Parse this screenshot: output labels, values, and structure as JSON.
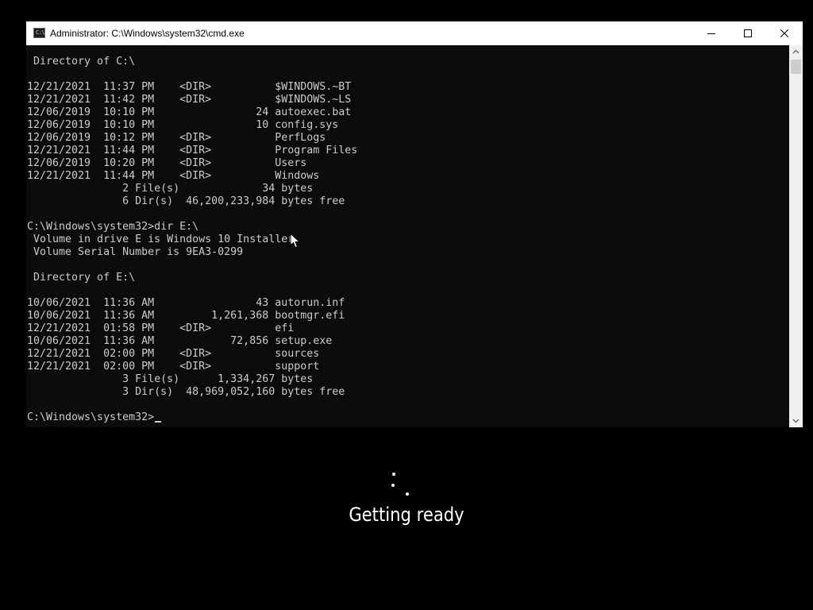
{
  "window": {
    "title": "Administrator: C:\\Windows\\system32\\cmd.exe",
    "icon": "cmd-console-icon",
    "icon_glyph": "C:\\"
  },
  "console": {
    "lines": [
      " Directory of C:\\",
      "",
      "12/21/2021  11:37 PM    <DIR>          $WINDOWS.~BT",
      "12/21/2021  11:42 PM    <DIR>          $WINDOWS.~LS",
      "12/06/2019  10:10 PM                24 autoexec.bat",
      "12/06/2019  10:10 PM                10 config.sys",
      "12/06/2019  10:12 PM    <DIR>          PerfLogs",
      "12/21/2021  11:44 PM    <DIR>          Program Files",
      "12/06/2019  10:20 PM    <DIR>          Users",
      "12/21/2021  11:44 PM    <DIR>          Windows",
      "               2 File(s)             34 bytes",
      "               6 Dir(s)  46,200,233,984 bytes free",
      "",
      "C:\\Windows\\system32>dir E:\\",
      " Volume in drive E is Windows 10 Installer",
      " Volume Serial Number is 9EA3-0299",
      "",
      " Directory of E:\\",
      "",
      "10/06/2021  11:36 AM                43 autorun.inf",
      "10/06/2021  11:36 AM         1,261,368 bootmgr.efi",
      "12/21/2021  01:58 PM    <DIR>          efi",
      "10/06/2021  11:36 AM            72,856 setup.exe",
      "12/21/2021  02:00 PM    <DIR>          sources",
      "12/21/2021  02:00 PM    <DIR>          support",
      "               3 File(s)      1,334,267 bytes",
      "               3 Dir(s)  48,969,052,160 bytes free",
      "",
      "C:\\Windows\\system32>"
    ]
  },
  "status": {
    "text": "Getting ready"
  },
  "colors": {
    "console_background": "#0c0c0c",
    "console_text": "#cccccc",
    "screen_background": "#000000",
    "status_text": "#ffffff"
  }
}
